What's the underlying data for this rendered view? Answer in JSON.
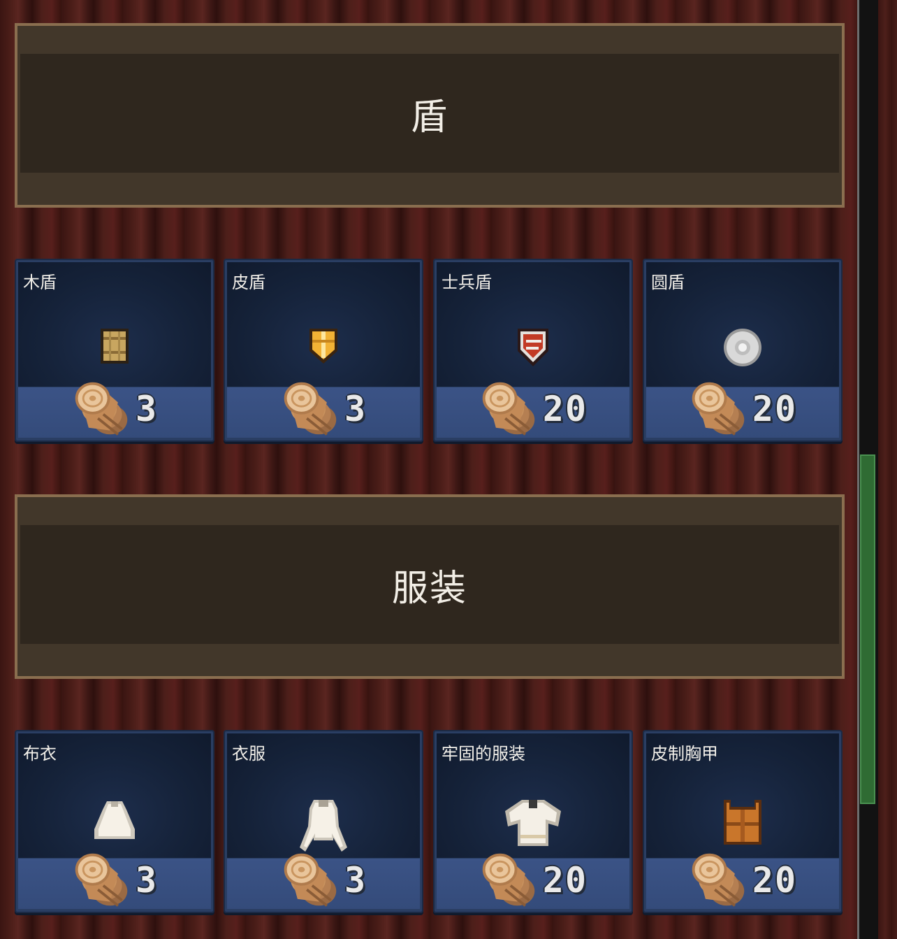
{
  "sections": [
    {
      "title": "盾",
      "items": [
        {
          "name": "木盾",
          "icon": "wooden-shield-icon",
          "cost": "3"
        },
        {
          "name": "皮盾",
          "icon": "leather-shield-icon",
          "cost": "3"
        },
        {
          "name": "士兵盾",
          "icon": "soldier-shield-icon",
          "cost": "20"
        },
        {
          "name": "圆盾",
          "icon": "round-shield-icon",
          "cost": "20"
        }
      ]
    },
    {
      "title": "服装",
      "items": [
        {
          "name": "布衣",
          "icon": "cloth-shirt-icon",
          "cost": "3"
        },
        {
          "name": "衣服",
          "icon": "clothes-icon",
          "cost": "3"
        },
        {
          "name": "牢固的服装",
          "icon": "sturdy-clothes-icon",
          "cost": "20"
        },
        {
          "name": "皮制胸甲",
          "icon": "leather-chestplate-icon",
          "cost": "20"
        }
      ]
    }
  ],
  "cost_resource_icon": "wood-log-icon",
  "colors": {
    "scrollbar_thumb": "#2f6b33",
    "card_bottom": "#3b5386",
    "header_border": "#8a6e4f"
  }
}
